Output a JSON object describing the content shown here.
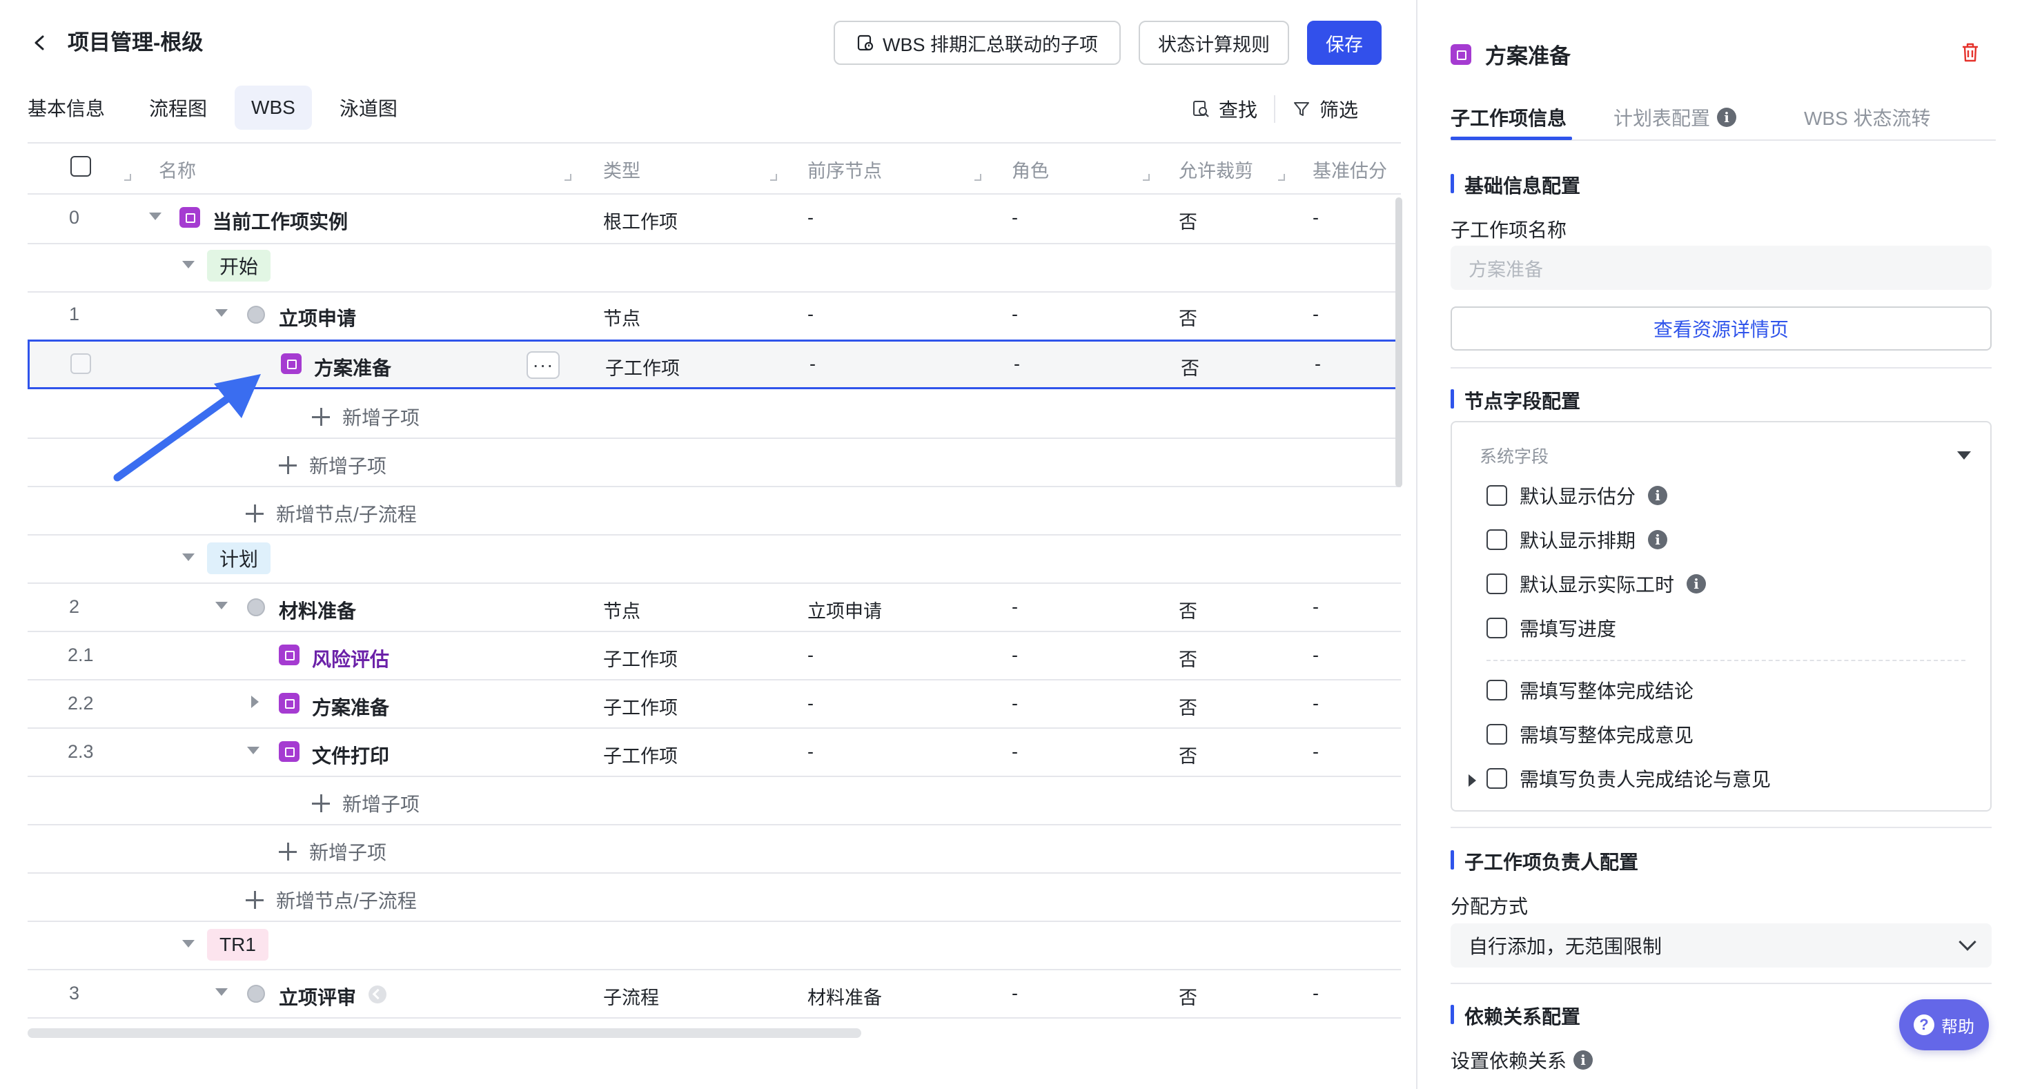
{
  "header": {
    "title": "项目管理-根级",
    "wbs_button": "WBS 排期汇总联动的子项",
    "rule_button": "状态计算规则",
    "save_button": "保存"
  },
  "tabs": [
    "基本信息",
    "流程图",
    "WBS",
    "泳道图"
  ],
  "active_tab": "WBS",
  "tools": {
    "find": "查找",
    "filter": "筛选"
  },
  "table": {
    "columns": [
      "名称",
      "类型",
      "前序节点",
      "角色",
      "允许裁剪",
      "基准估分"
    ],
    "rows": [
      {
        "idx": "0",
        "name": "当前工作项实例",
        "type": "根工作项",
        "pre": "-",
        "role": "-",
        "cut": "否",
        "est": "-"
      },
      {
        "group": "开始"
      },
      {
        "idx": "1",
        "name": "立项申请",
        "type": "节点",
        "pre": "-",
        "role": "-",
        "cut": "否",
        "est": "-"
      },
      {
        "idx": "",
        "name": "方案准备",
        "type": "子工作项",
        "pre": "-",
        "role": "-",
        "cut": "否",
        "est": "-",
        "more": "···"
      },
      {
        "add": "新增子项"
      },
      {
        "add": "新增子项"
      },
      {
        "add": "新增节点/子流程"
      },
      {
        "group": "计划"
      },
      {
        "idx": "2",
        "name": "材料准备",
        "type": "节点",
        "pre": "立项申请",
        "role": "-",
        "cut": "否",
        "est": "-"
      },
      {
        "idx": "2.1",
        "name": "风险评估",
        "type": "子工作项",
        "pre": "-",
        "role": "-",
        "cut": "否",
        "est": "-"
      },
      {
        "idx": "2.2",
        "name": "方案准备",
        "type": "子工作项",
        "pre": "-",
        "role": "-",
        "cut": "否",
        "est": "-"
      },
      {
        "idx": "2.3",
        "name": "文件打印",
        "type": "子工作项",
        "pre": "-",
        "role": "-",
        "cut": "否",
        "est": "-"
      },
      {
        "add": "新增子项"
      },
      {
        "add": "新增子项"
      },
      {
        "add": "新增节点/子流程"
      },
      {
        "group": "TR1"
      },
      {
        "idx": "3",
        "name": "立项评审",
        "type": "子流程",
        "pre": "材料准备",
        "role": "-",
        "cut": "否",
        "est": "-"
      }
    ]
  },
  "panel": {
    "title": "方案准备",
    "tabs": [
      "子工作项信息",
      "计划表配置",
      "WBS 状态流转"
    ],
    "basic_section": "基础信息配置",
    "name_label": "子工作项名称",
    "name_placeholder": "方案准备",
    "view_resource": "查看资源详情页",
    "node_section": "节点字段配置",
    "system_fields": "系统字段",
    "options": [
      "默认显示估分",
      "默认显示排期",
      "默认显示实际工时",
      "需填写进度",
      "需填写整体完成结论",
      "需填写整体完成意见",
      "需填写负责人完成结论与意见"
    ],
    "owner_section": "子工作项负责人配置",
    "assign_label": "分配方式",
    "assign_value": "自行添加，无范围限制",
    "dep_section": "依赖关系配置",
    "dep_label": "设置依赖关系"
  },
  "help": "帮助",
  "colors": {
    "primary": "#3250eb",
    "task_icon": "#a53bd1",
    "purple_text": "#6b21a8",
    "arrow": "#3a6df0"
  },
  "icons": [
    "back-chevron-icon",
    "schedule-icon",
    "search-icon",
    "filter-icon",
    "trash-icon",
    "info-icon",
    "question-icon"
  ]
}
